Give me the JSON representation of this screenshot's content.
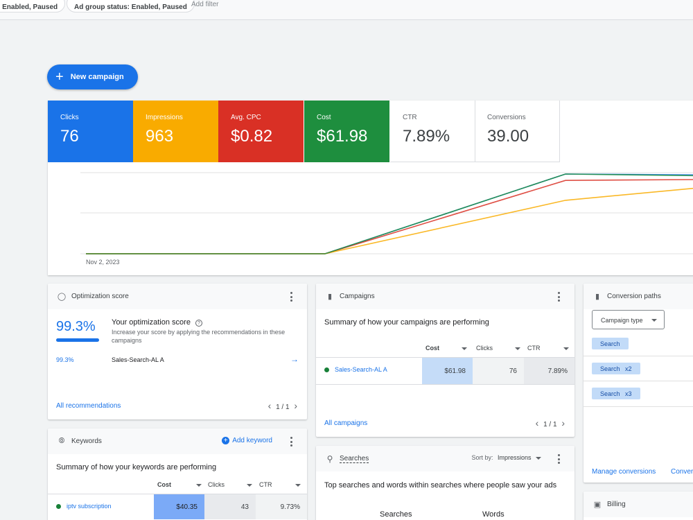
{
  "filters": {
    "chip1": ": Enabled, Paused",
    "chip2": "Ad group status: Enabled, Paused",
    "add_filter": "Add filter"
  },
  "new_campaign_label": "New campaign",
  "metrics": [
    {
      "label": "Clicks",
      "value": "76",
      "color": "#1a73e8"
    },
    {
      "label": "Impressions",
      "value": "963",
      "color": "#f9ab00"
    },
    {
      "label": "Avg. CPC",
      "value": "$0.82",
      "color": "#d93025"
    },
    {
      "label": "Cost",
      "value": "$61.98",
      "color": "#1e8e3e"
    },
    {
      "label": "CTR",
      "value": "7.89%"
    },
    {
      "label": "Conversions",
      "value": "39.00"
    }
  ],
  "chart_data": {
    "type": "line",
    "x_label_start": "Nov 2, 2023",
    "series": [
      {
        "color": "#1a73e8",
        "values": [
          0,
          0,
          1.0,
          0.99
        ]
      },
      {
        "color": "#d93025",
        "values": [
          0,
          0,
          0.92,
          0.93
        ]
      },
      {
        "color": "#f9ab00",
        "values": [
          0,
          0,
          0.67,
          0.82
        ]
      },
      {
        "color": "#1e8e3e",
        "values": [
          0,
          0,
          1.0,
          0.98
        ]
      }
    ]
  },
  "optimization": {
    "header": "Optimization score",
    "score": "99.3%",
    "score_fraction": 0.993,
    "title": "Your optimization score",
    "description": "Increase your score by applying the recommendations in these campaigns",
    "row_score": "99.3%",
    "row_campaign": "Sales-Search-AL A",
    "link": "All recommendations",
    "page": "1 / 1"
  },
  "campaigns": {
    "header": "Campaigns",
    "summary": "Summary of how your campaigns are performing",
    "columns": [
      "Cost",
      "Clicks",
      "CTR"
    ],
    "row": {
      "name": "Sales-Search-AL A",
      "cost": "$61.98",
      "clicks": "76",
      "ctr": "7.89%"
    },
    "link": "All campaigns",
    "page": "1 / 1"
  },
  "conversion_paths": {
    "header": "Conversion paths",
    "dropdown": "Campaign type",
    "paths": [
      "Search",
      "Search   x2",
      "Search   x3"
    ],
    "link1": "Manage conversions",
    "link2": "Conver"
  },
  "keywords": {
    "header": "Keywords",
    "add": "Add keyword",
    "summary": "Summary of how your keywords are performing",
    "columns": [
      "Cost",
      "Clicks",
      "CTR"
    ],
    "row": {
      "name": "iptv subscription",
      "cost": "$40.35",
      "clicks": "43",
      "ctr": "9.73%"
    }
  },
  "searches": {
    "header": "Searches",
    "sort_label": "Sort by:",
    "sort_value": "Impressions",
    "description": "Top searches and words within searches where people saw your ads",
    "col1": "Searches",
    "col2": "Words"
  },
  "billing": {
    "header": "Billing"
  }
}
